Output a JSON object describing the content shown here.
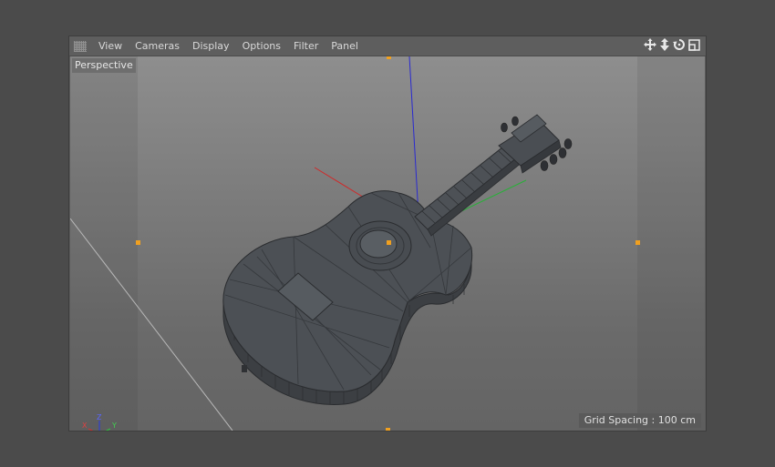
{
  "menu": {
    "items": [
      "View",
      "Cameras",
      "Display",
      "Options",
      "Filter",
      "Panel"
    ]
  },
  "nav_icons": [
    "move-view-icon",
    "dolly-view-icon",
    "rotate-view-icon",
    "maximize-view-icon"
  ],
  "viewport": {
    "label": "Perspective",
    "grid_spacing": "Grid Spacing : 100 cm",
    "axis_labels": {
      "x": "X",
      "y": "Y",
      "z": "Z"
    }
  },
  "colors": {
    "background": "#4b4b4b",
    "model": "#4a4e53",
    "handles": "#f0a020",
    "axis_x": "#d03030",
    "axis_y": "#30c040",
    "axis_z": "#3040d0"
  }
}
